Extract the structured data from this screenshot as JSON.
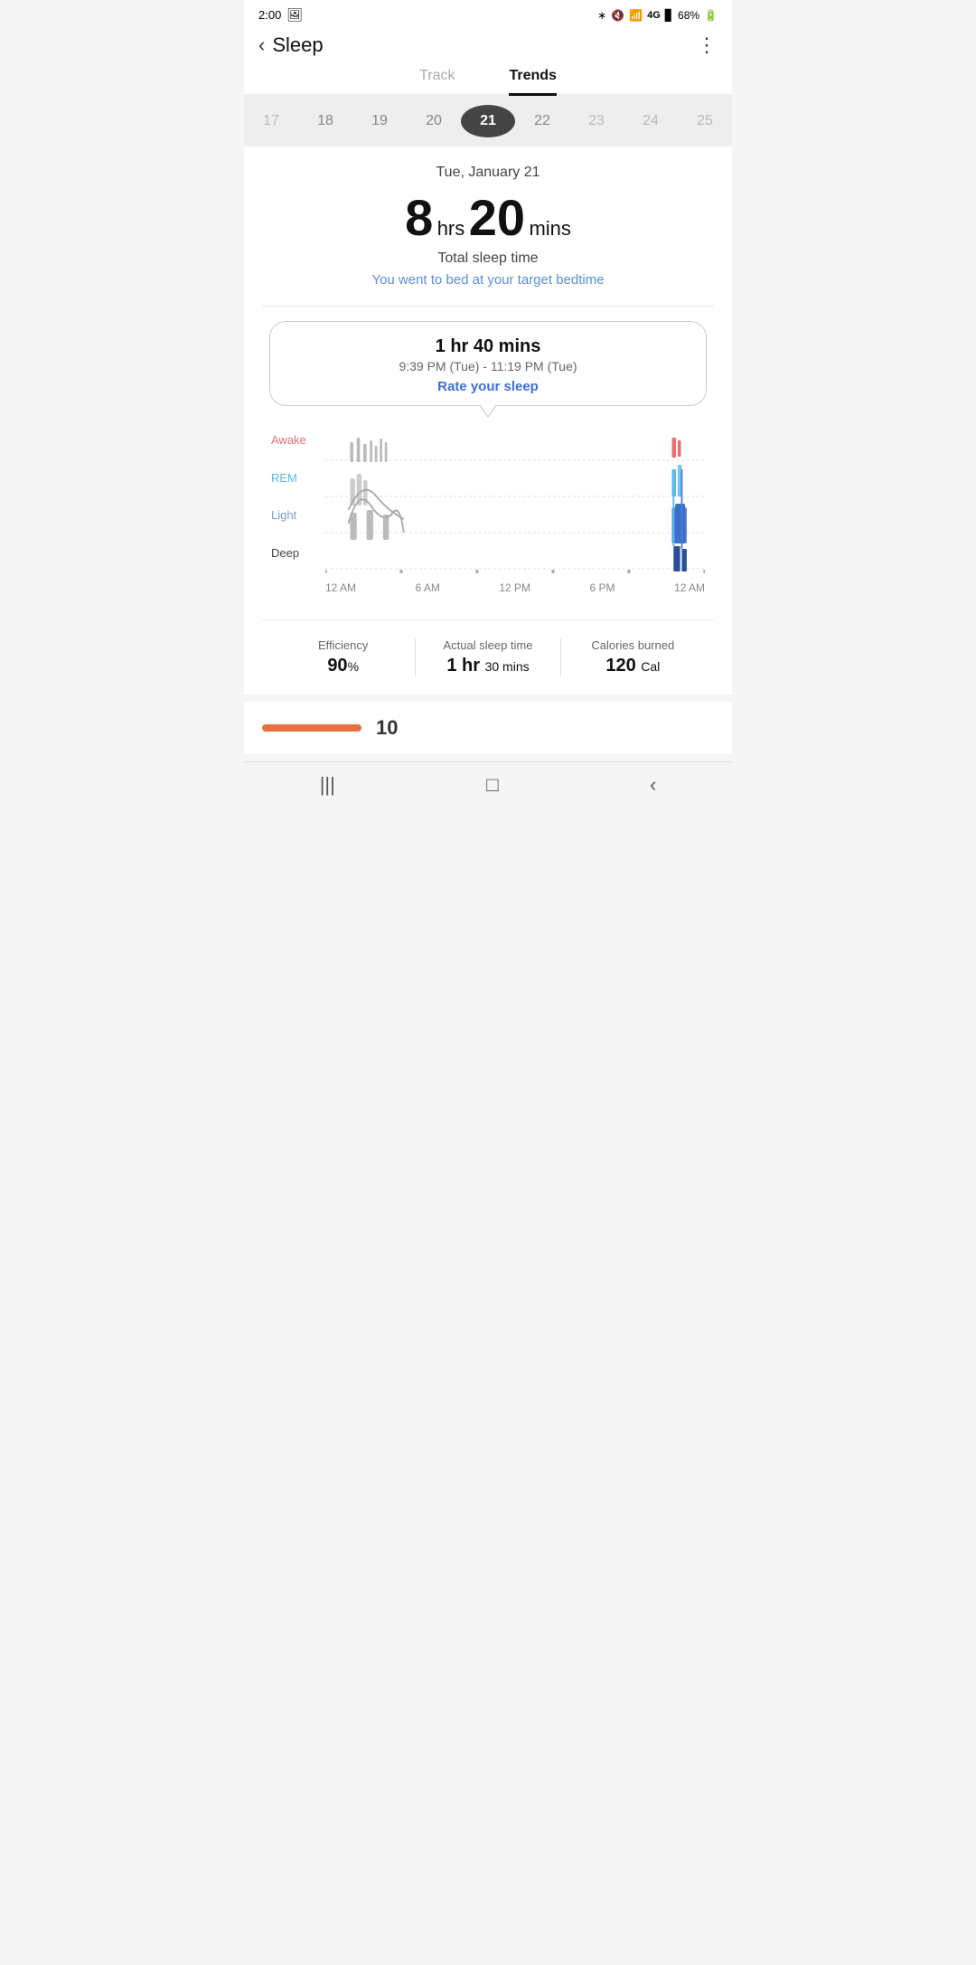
{
  "statusBar": {
    "time": "2:00",
    "battery": "68%",
    "signal": "4G"
  },
  "header": {
    "back": "‹",
    "title": "Sleep",
    "more": "⋮"
  },
  "tabs": [
    {
      "id": "track",
      "label": "Track",
      "active": false
    },
    {
      "id": "trends",
      "label": "Trends",
      "active": true
    }
  ],
  "dateSlider": {
    "dates": [
      {
        "day": "17",
        "faded": true
      },
      {
        "day": "18",
        "faded": false
      },
      {
        "day": "19",
        "faded": false
      },
      {
        "day": "20",
        "faded": false
      },
      {
        "day": "21",
        "active": true
      },
      {
        "day": "22",
        "faded": false
      },
      {
        "day": "23",
        "faded": true
      },
      {
        "day": "24",
        "faded": true
      },
      {
        "day": "25",
        "faded": true
      }
    ]
  },
  "sleepSummary": {
    "dateLabel": "Tue, January 21",
    "hours": "8",
    "hrsLabel": "hrs",
    "mins": "20",
    "minsLabel": "mins",
    "totalLabel": "Total sleep time",
    "targetMsg": "You went to bed at your target bedtime"
  },
  "sessionBubble": {
    "duration": "1 hr 40 mins",
    "timeRange": "9:39 PM (Tue) - 11:19 PM (Tue)",
    "rateLabel": "Rate your sleep"
  },
  "chart": {
    "yLabels": [
      {
        "id": "awake",
        "label": "Awake"
      },
      {
        "id": "rem",
        "label": "REM"
      },
      {
        "id": "light",
        "label": "Light"
      },
      {
        "id": "deep",
        "label": "Deep"
      }
    ],
    "xLabels": [
      "12 AM",
      "6 AM",
      "12 PM",
      "6 PM",
      "12 AM"
    ]
  },
  "stats": [
    {
      "label": "Efficiency",
      "value": "90",
      "unit": "%",
      "unitAfter": false
    },
    {
      "label": "Actual sleep time",
      "value": "1 hr",
      "unit": "30 mins",
      "combined": true
    },
    {
      "label": "Calories burned",
      "value": "120",
      "unit": "Cal"
    }
  ],
  "bottomSection": {
    "number": "10"
  },
  "navBar": {
    "icons": [
      "|||",
      "□",
      "‹"
    ]
  }
}
